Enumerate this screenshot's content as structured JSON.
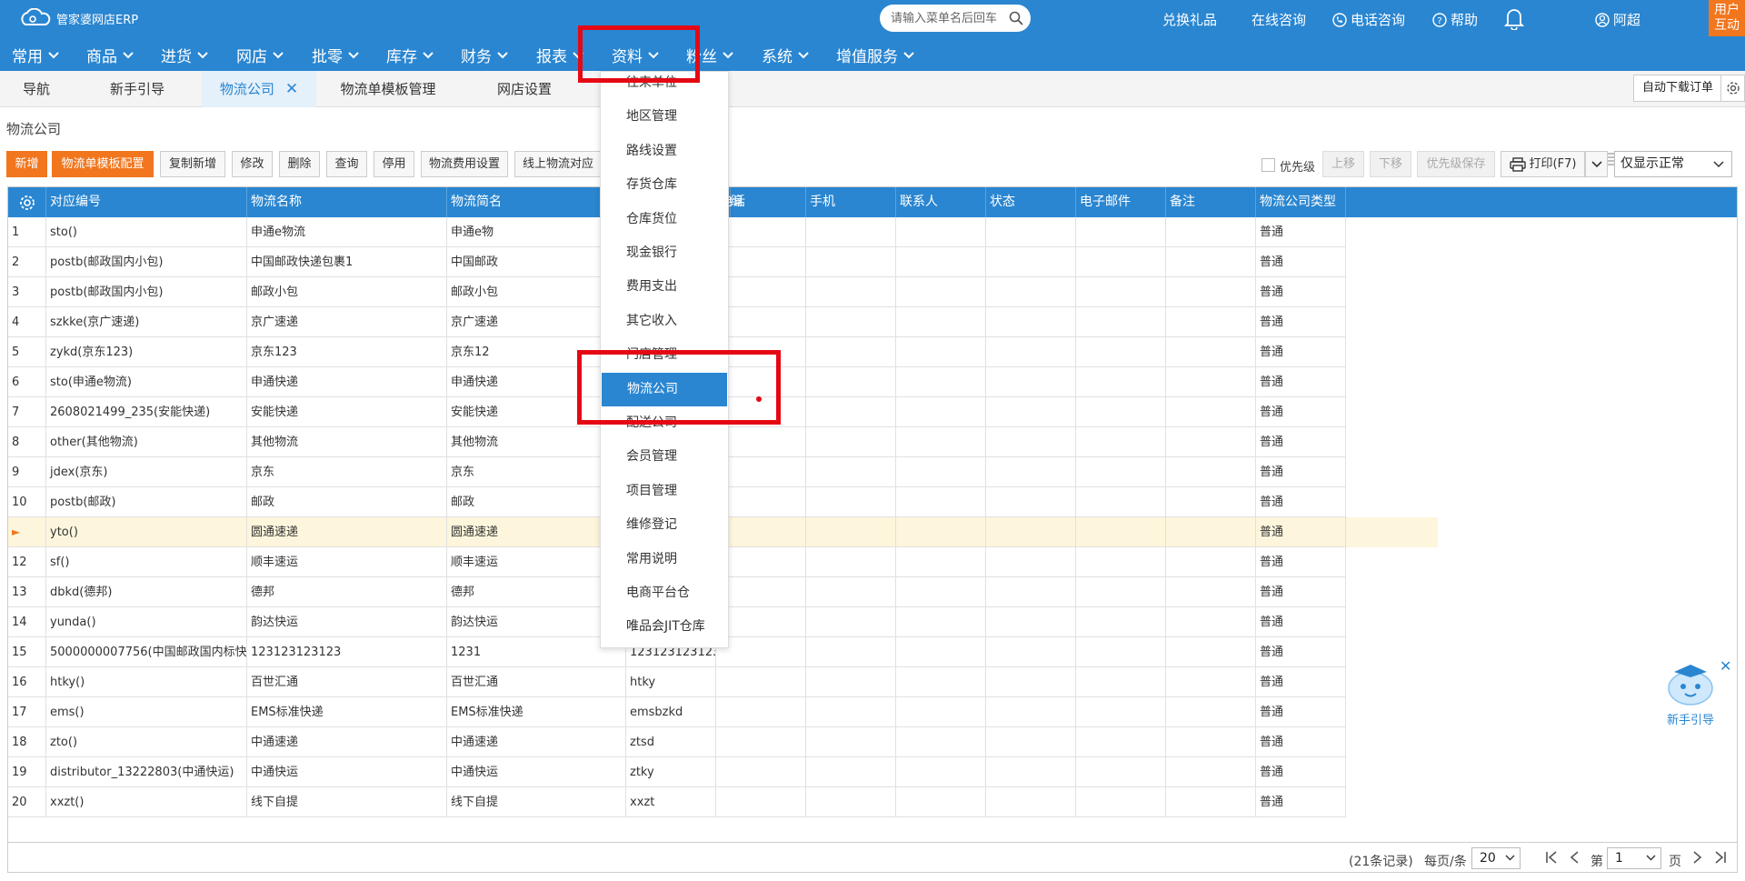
{
  "app": {
    "logo_text": "管家婆网店ERP"
  },
  "search": {
    "placeholder": "请输入菜单名后回车"
  },
  "top_links": {
    "gift": "兑换礼品",
    "online": "在线咨询",
    "phone": "电话咨询",
    "help": "帮助",
    "user": "阿超",
    "interact": "用户互动"
  },
  "menu": [
    "常用",
    "商品",
    "进货",
    "网店",
    "批零",
    "库存",
    "财务",
    "报表",
    "资料",
    "粉丝",
    "系统",
    "增值服务"
  ],
  "tabs": [
    "导航",
    "新手引导",
    "物流公司",
    "物流单模板管理",
    "网店设置"
  ],
  "active_tab": 2,
  "auto_download": "自动下载订单",
  "page_title": "物流公司",
  "toolbar": {
    "add": "新增",
    "template_config": "物流单模板配置",
    "copy_add": "复制新增",
    "edit": "修改",
    "delete": "删除",
    "query": "查询",
    "disable": "停用",
    "fee_setting": "物流费用设置",
    "online_logistics": "线上物流对应",
    "priority": "优先级",
    "up": "上移",
    "down": "下移",
    "save_priority": "优先级保存",
    "print": "打印(F7)",
    "filter": "仅显示正常"
  },
  "columns": [
    "对应编号",
    "物流名称",
    "物流简名",
    "编号",
    "电话",
    "手机",
    "联系人",
    "状态",
    "电子邮件",
    "备注",
    "物流公司类型"
  ],
  "rows": [
    {
      "n": "1",
      "code": "sto()",
      "name": "申通e物流",
      "short": "申通e物",
      "no": "",
      "type": "普通"
    },
    {
      "n": "2",
      "code": "postb(邮政国内小包)",
      "name": "中国邮政快递包裹1",
      "short": "中国邮政",
      "no": "",
      "type": "普通"
    },
    {
      "n": "3",
      "code": "postb(邮政国内小包)",
      "name": "邮政小包",
      "short": "邮政小包",
      "no": "",
      "type": "普通"
    },
    {
      "n": "4",
      "code": "szkke(京广速递)",
      "name": "京广速递",
      "short": "京广速递",
      "no": "",
      "type": "普通"
    },
    {
      "n": "5",
      "code": "zykd(京东123)",
      "name": "京东123",
      "short": "京东12",
      "no": "",
      "type": "普通"
    },
    {
      "n": "6",
      "code": "sto(申通e物流)",
      "name": "申通快递",
      "short": "申通快递",
      "no": "",
      "type": "普通"
    },
    {
      "n": "7",
      "code": "2608021499_235(安能快递)",
      "name": "安能快递",
      "short": "安能快递",
      "no": "",
      "type": "普通"
    },
    {
      "n": "8",
      "code": "other(其他物流)",
      "name": "其他物流",
      "short": "其他物流",
      "no": "",
      "type": "普通"
    },
    {
      "n": "9",
      "code": "jdex(京东)",
      "name": "京东",
      "short": "京东",
      "no": "",
      "type": "普通"
    },
    {
      "n": "10",
      "code": "postb(邮政)",
      "name": "邮政",
      "short": "邮政",
      "no": "",
      "type": "普通"
    },
    {
      "n": "►",
      "code": "yto()",
      "name": "圆通速递",
      "short": "圆通速递",
      "no": "",
      "type": "普通"
    },
    {
      "n": "12",
      "code": "sf()",
      "name": "顺丰速运",
      "short": "顺丰速运",
      "no": "",
      "type": "普通"
    },
    {
      "n": "13",
      "code": "dbkd(德邦)",
      "name": "德邦",
      "short": "德邦",
      "no": "",
      "type": "普通"
    },
    {
      "n": "14",
      "code": "yunda()",
      "name": "韵达快运",
      "short": "韵达快运",
      "no": "",
      "type": "普通"
    },
    {
      "n": "15",
      "code": "5000000007756(中国邮政国内标快)",
      "name": "123123123123",
      "short": "1231",
      "no": "123123123123",
      "type": "普通"
    },
    {
      "n": "16",
      "code": "htky()",
      "name": "百世汇通",
      "short": "百世汇通",
      "no": "htky",
      "type": "普通"
    },
    {
      "n": "17",
      "code": "ems()",
      "name": "EMS标准快递",
      "short": "EMS标准快递",
      "no": "emsbzkd",
      "type": "普通"
    },
    {
      "n": "18",
      "code": "zto()",
      "name": "中通速递",
      "short": "中通速递",
      "no": "ztsd",
      "type": "普通"
    },
    {
      "n": "19",
      "code": "distributor_13222803(中通快运)",
      "name": "中通快运",
      "short": "中通快运",
      "no": "ztky",
      "type": "普通"
    },
    {
      "n": "20",
      "code": "xxzt()",
      "name": "线下自提",
      "short": "线下自提",
      "no": "xxzt",
      "type": "普通"
    }
  ],
  "dropdown": [
    "往来单位",
    "地区管理",
    "路线设置",
    "存货仓库",
    "仓库货位",
    "现金银行",
    "费用支出",
    "其它收入",
    "门店管理",
    "物流公司",
    "配送公司",
    "会员管理",
    "项目管理",
    "维修登记",
    "常用说明",
    "电商平台仓",
    "唯品会JIT仓库"
  ],
  "dropdown_active": 9,
  "footer": {
    "records": "(21条记录)",
    "per_page_label": "每页/条",
    "per_page": "20",
    "page_prefix": "第",
    "page": "1",
    "page_suffix": "页"
  },
  "helper": {
    "label": "新手引导"
  },
  "colors": {
    "primary": "#2a86d1",
    "orange": "#f1761e",
    "highlight_red": "#e50914"
  }
}
